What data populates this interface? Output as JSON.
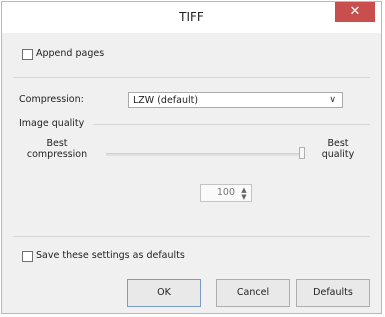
{
  "window": {
    "title": "TIFF",
    "close_glyph": "✕"
  },
  "append_pages": {
    "label": "Append pages",
    "checked": false
  },
  "compression": {
    "label": "Compression:",
    "value": "LZW (default)"
  },
  "image_quality": {
    "section_label": "Image quality",
    "min_label": "Best compression",
    "max_label": "Best quality",
    "slider_value_percent": 100,
    "value": "100"
  },
  "save_defaults": {
    "label": "Save these settings as defaults",
    "checked": false
  },
  "buttons": {
    "ok": "OK",
    "cancel": "Cancel",
    "defaults": "Defaults"
  }
}
